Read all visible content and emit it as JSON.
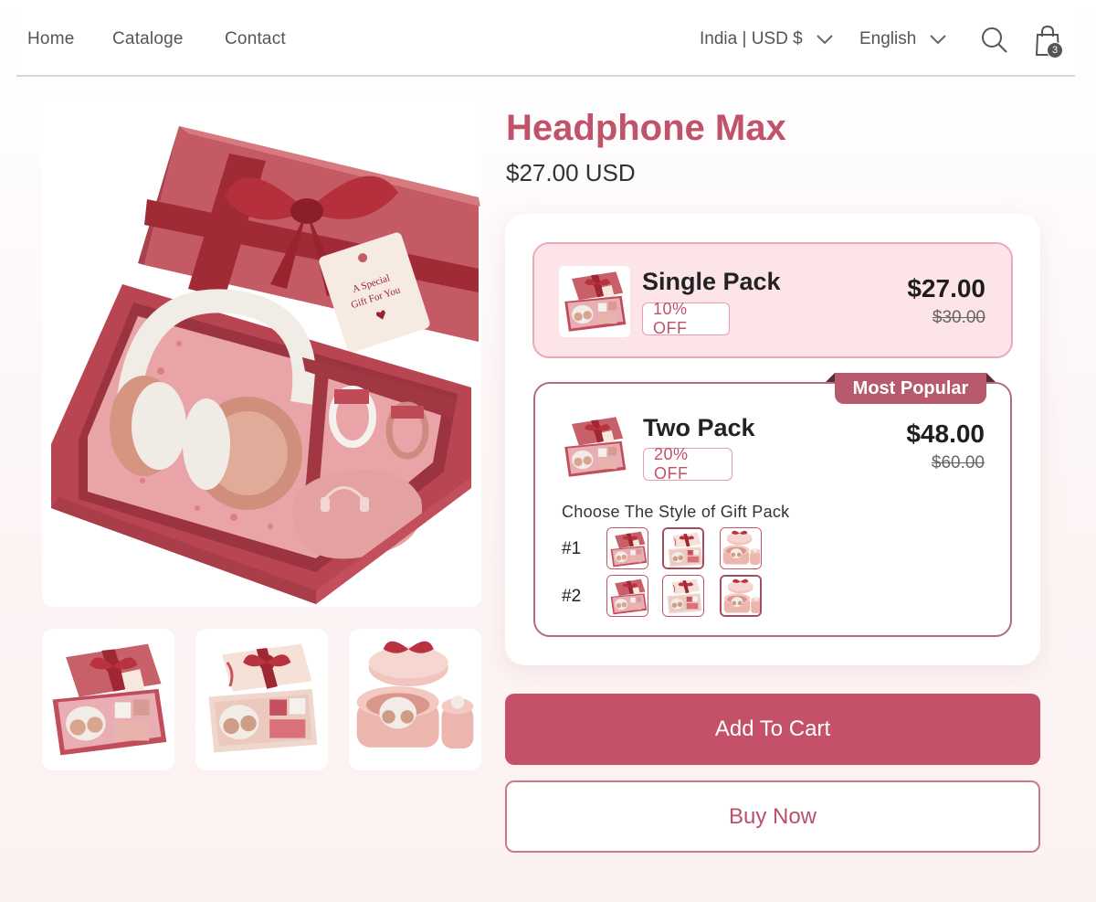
{
  "nav": {
    "links": [
      "Home",
      "Cataloge",
      "Contact"
    ],
    "region": "India | USD $",
    "language": "English",
    "cart_count": "3"
  },
  "product": {
    "title": "Headphone Max",
    "price": "$27.00 USD",
    "gift_tag_text": "A Special Gift For You"
  },
  "packs": {
    "single": {
      "name": "Single Pack",
      "discount": "10% OFF",
      "price": "$27.00",
      "old_price": "$30.00"
    },
    "two": {
      "badge": "Most Popular",
      "name": "Two Pack",
      "discount": "20% OFF",
      "price": "$48.00",
      "old_price": "$60.00",
      "style_prompt": "Choose The Style of Gift Pack",
      "row_labels": [
        "#1",
        "#2"
      ],
      "selected_row1": 2,
      "selected_row2": 3
    }
  },
  "buttons": {
    "add_to_cart": "Add To Cart",
    "buy_now": "Buy Now"
  },
  "colors": {
    "accent": "#c0526a",
    "button": "#c45168",
    "box_red": "#c4515f",
    "box_cream": "#f3ddd4",
    "pink_highlight": "#fde4e8"
  }
}
